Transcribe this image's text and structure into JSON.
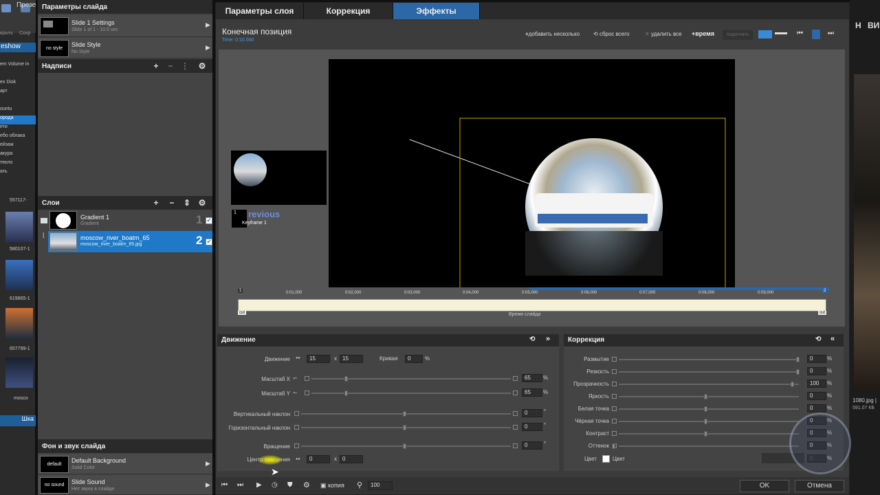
{
  "app_strip": {
    "top_labels": [
      "крыть",
      "Сохр"
    ],
    "menu_fragment": "Презе",
    "slideshow_fragment": "eshow",
    "tree_items": [
      "em Volume in",
      "",
      "ex Disk",
      "арт",
      "",
      "ountu",
      "орода",
      "ети",
      "ебо облака",
      "ейзаж",
      "акура",
      "текло",
      "ать"
    ],
    "thumb_labels": [
      "557117-",
      "580107-1",
      "619865-1",
      "657799-1",
      "mosco"
    ],
    "bottom_fragment": "Шка"
  },
  "right_strip": {
    "items": [
      "Н",
      "ВИ",
      "1080.jpg |",
      "591.07 КБ"
    ]
  },
  "left_panel": {
    "slide_params_title": "Параметры слайда",
    "slide_settings": {
      "title": "Slide 1 Settings",
      "subtitle": "Slide 1 of 1 - 10.0 sec"
    },
    "slide_style": {
      "thumb_text": "no style",
      "title": "Slide Style",
      "subtitle": "No Style"
    },
    "captions_title": "Надписи",
    "layers_title": "Слои",
    "layers": [
      {
        "name": "Gradient 1",
        "sub": "Gradient",
        "num": "1"
      },
      {
        "name": "moscow_river_boatm_65",
        "sub": "moscow_river_boatm_65.jpg",
        "num": "2"
      }
    ],
    "bg_sound_title": "Фон и звук слайда",
    "background": {
      "thumb_text": "default",
      "title": "Default Background",
      "subtitle": "Solid Color"
    },
    "sound": {
      "thumb_text": "no sound",
      "title": "Slide Sound",
      "subtitle": "Нет звука в слайде"
    }
  },
  "tabs": [
    "Параметры слоя",
    "Коррекция",
    "Эффекты"
  ],
  "preview": {
    "title": "Конечная позиция",
    "time": "Time: 0:10.000",
    "toolbar": {
      "add_several": "добавить несколько",
      "reset_all": "сброс всего",
      "delete_all": "удалить все",
      "time": "время",
      "match": "подогнать"
    },
    "prev_label": "revious",
    "keyframe_label": "Keyframe 1"
  },
  "timeline": {
    "ticks": [
      "0:01,000",
      "0:02,000",
      "0:03,000",
      "0:04,000",
      "0:05,000",
      "0:06,000",
      "0:07,000",
      "0:08,000",
      "0:09,000"
    ],
    "cut_left": "cut",
    "cut_right": "cut",
    "label": "Время слайда",
    "marker_left": "1",
    "marker_right": "2"
  },
  "motion": {
    "title": "Движение",
    "move_label": "Движение",
    "move_x": "15",
    "move_y": "15",
    "curve_label": "Кривая",
    "curve_value": "0",
    "percent": "%",
    "x_sep": "x",
    "scale_x_label": "Масштаб X",
    "scale_x_value": "65",
    "scale_x_fraction": 0.17,
    "scale_y_label": "Масштаб Y",
    "scale_y_value": "65",
    "scale_y_fraction": 0.17,
    "vtilt_label": "Вертикальный наклон",
    "vtilt_value": "0",
    "htilt_label": "Горизонтальный наклон",
    "htilt_value": "0",
    "rotation_label": "Вращение",
    "rotation_value": "0",
    "degree": "°",
    "center_label": "Центр вращения",
    "center_x": "0",
    "center_y": "0"
  },
  "correction": {
    "title": "Коррекция",
    "rows": [
      {
        "label": "Размытие",
        "value": "0",
        "fraction": 1.0
      },
      {
        "label": "Резкость",
        "value": "0",
        "fraction": 1.0
      },
      {
        "label": "Прозрачность",
        "value": "100",
        "fraction": 0.97
      },
      {
        "label": "Яркость",
        "value": "0",
        "fraction": 0.5
      },
      {
        "label": "Белая точка",
        "value": "0",
        "fraction": 0.5
      },
      {
        "label": "Чёрная точка",
        "value": "0",
        "fraction": 0.5
      },
      {
        "label": "Контраст",
        "value": "0",
        "fraction": 0.5
      },
      {
        "label": "Оттенок",
        "value": "0",
        "fraction": 0.0
      }
    ],
    "color_label": "Цвет",
    "color_name": "Цвет",
    "color_value": "0"
  },
  "bottom_bar": {
    "copy_label": "копия",
    "zoom_value": "100",
    "ok": "OK",
    "cancel": "Отмена"
  },
  "colors": {
    "accent": "#2c67a8",
    "selection": "#1f78c8",
    "timeline_bg": "#f5f0d8",
    "frame_yellow": "#c8a800"
  }
}
